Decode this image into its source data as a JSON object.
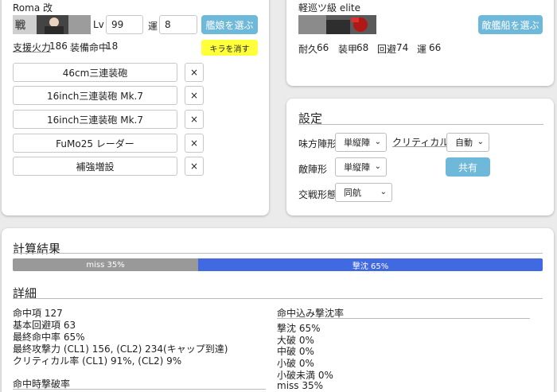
{
  "friend": {
    "ship_name": "Roma 改",
    "lv_label": "Lv",
    "lv_value": "99",
    "luck_label": "運",
    "luck_value": "8",
    "select_button": "艦娘を選ぶ",
    "support_fp_label": "支援火力",
    "support_fp_value": "186",
    "equip_acc_label": "装備命中",
    "equip_acc_value": "18",
    "kira_button": "キラを消す",
    "equipment": [
      {
        "name": "46cm三連装砲",
        "remove": "×"
      },
      {
        "name": "16inch三連装砲 Mk.7",
        "remove": "×"
      },
      {
        "name": "16inch三連装砲 Mk.7",
        "remove": "×"
      },
      {
        "name": "FuMo25 レーダー",
        "remove": "×"
      },
      {
        "name": "補強増設",
        "remove": "×"
      }
    ],
    "banner_text": "戦"
  },
  "enemy": {
    "ship_name": "軽巡ツ級 elite",
    "select_button": "敵艦船を選ぶ",
    "hp_label": "耐久",
    "hp_value": "66",
    "armor_label": "装甲",
    "armor_value": "68",
    "evasion_label": "回避",
    "evasion_value": "74",
    "luck_label": "運",
    "luck_value": "66"
  },
  "settings": {
    "title": "設定",
    "friend_formation_label": "味方陣形",
    "friend_formation_value": "単縦陣",
    "critical_label": "クリティカル",
    "critical_value": "自動",
    "enemy_formation_label": "敵陣形",
    "enemy_formation_value": "単縦陣",
    "share_button": "共有",
    "engagement_label": "交戦形態",
    "engagement_value": "同航"
  },
  "results": {
    "title": "計算結果",
    "miss_label": "miss 35%",
    "miss_fraction": 0.35,
    "sink_label": "撃沈 65%",
    "sink_fraction": 0.65,
    "detail_title": "詳細",
    "details": [
      "命中項 127",
      "基本回避項 63",
      "最終命中率 65%",
      "最終攻撃力 (CL1) 156, (CL2) 234(キャップ到達)",
      "クリティカル率 (CL1) 91%, (CL2) 9%"
    ],
    "hit_damage_title": "命中時撃破率",
    "sink_rate_title": "命中込み撃沈率",
    "sink_rates": [
      "撃沈 65%",
      "大破 0%",
      "中破 0%",
      "小破 0%",
      "小破未満 0%",
      "miss 35%"
    ]
  },
  "colors": {
    "miss_bar": "#999999",
    "sink_bar": "#4169e1",
    "button_blue": "#6eb8d9",
    "kira_yellow": "#ffff3a"
  }
}
